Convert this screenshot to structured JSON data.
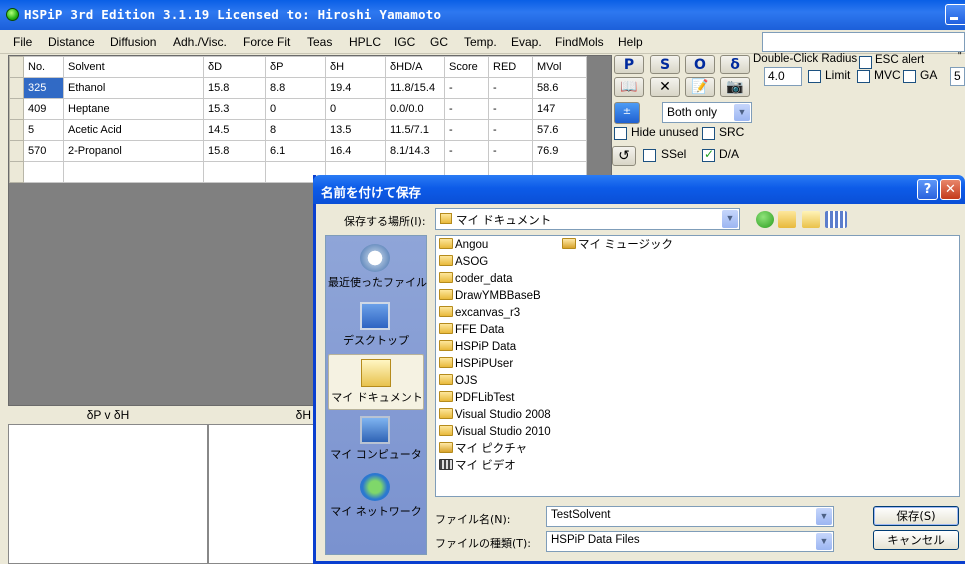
{
  "window": {
    "title": "HSPiP 3rd Edition 3.1.19 Licensed to: Hiroshi Yamamoto"
  },
  "menu": [
    "File",
    "Distance",
    "Diffusion",
    "Adh./Visc.",
    "Force Fit",
    "Teas",
    "HPLC",
    "IGC",
    "GC",
    "Temp.",
    "Evap.",
    "FindMols",
    "Help"
  ],
  "grid": {
    "columns": [
      "No.",
      "Solvent",
      "δD",
      "δP",
      "δH",
      "δHD/A",
      "Score",
      "RED",
      "MVol"
    ],
    "rows": [
      [
        "325",
        "Ethanol",
        "15.8",
        "8.8",
        "19.4",
        "11.8/15.4",
        "-",
        "-",
        "58.6"
      ],
      [
        "409",
        "Heptane",
        "15.3",
        "0",
        "0",
        "0.0/0.0",
        "-",
        "-",
        "147"
      ],
      [
        "5",
        "Acetic Acid",
        "14.5",
        "8",
        "13.5",
        "11.5/7.1",
        "-",
        "-",
        "57.6"
      ],
      [
        "570",
        "2-Propanol",
        "15.8",
        "6.1",
        "16.4",
        "8.1/14.3",
        "-",
        "-",
        "76.9"
      ]
    ]
  },
  "controls": {
    "psod_buttons": [
      "P",
      "S",
      "O",
      "δ"
    ],
    "double_click_radius_label": "Double-Click Radius",
    "radius_value": "4.0",
    "esc_alert": "ESC alert",
    "limit": "Limit",
    "mvc": "MVC",
    "ga": "GA",
    "ga_value": "5",
    "mode_select": "Both only",
    "hide_unused": "Hide unused",
    "src": "SRC",
    "ssel": "SSel",
    "da": "D/A"
  },
  "plots": {
    "left_title": "δP v δH",
    "right_title": "δH"
  },
  "dialog": {
    "title": "名前を付けて保存",
    "save_in_label": "保存する場所(I):",
    "save_in_value": "マイ ドキュメント",
    "places": [
      "最近使ったファイル",
      "デスクトップ",
      "マイ ドキュメント",
      "マイ コンピュータ",
      "マイ ネットワーク"
    ],
    "files_col1": [
      "Angou",
      "ASOG",
      "coder_data",
      "DrawYMBBaseB",
      "excanvas_r3",
      "FFE Data",
      "HSPiP Data",
      "HSPiPUser",
      "OJS",
      "PDFLibTest",
      "Visual Studio 2008",
      "Visual Studio 2010",
      "マイ ピクチャ",
      "マイ ビデオ"
    ],
    "files_col2": [
      "マイ ミュージック"
    ],
    "filename_label": "ファイル名(N):",
    "filename_value": "TestSolvent",
    "filetype_label": "ファイルの種類(T):",
    "filetype_value": "HSPiP Data Files",
    "save_button": "保存(S)",
    "cancel_button": "キャンセル",
    "help_button": "?",
    "close_button": "✕"
  }
}
